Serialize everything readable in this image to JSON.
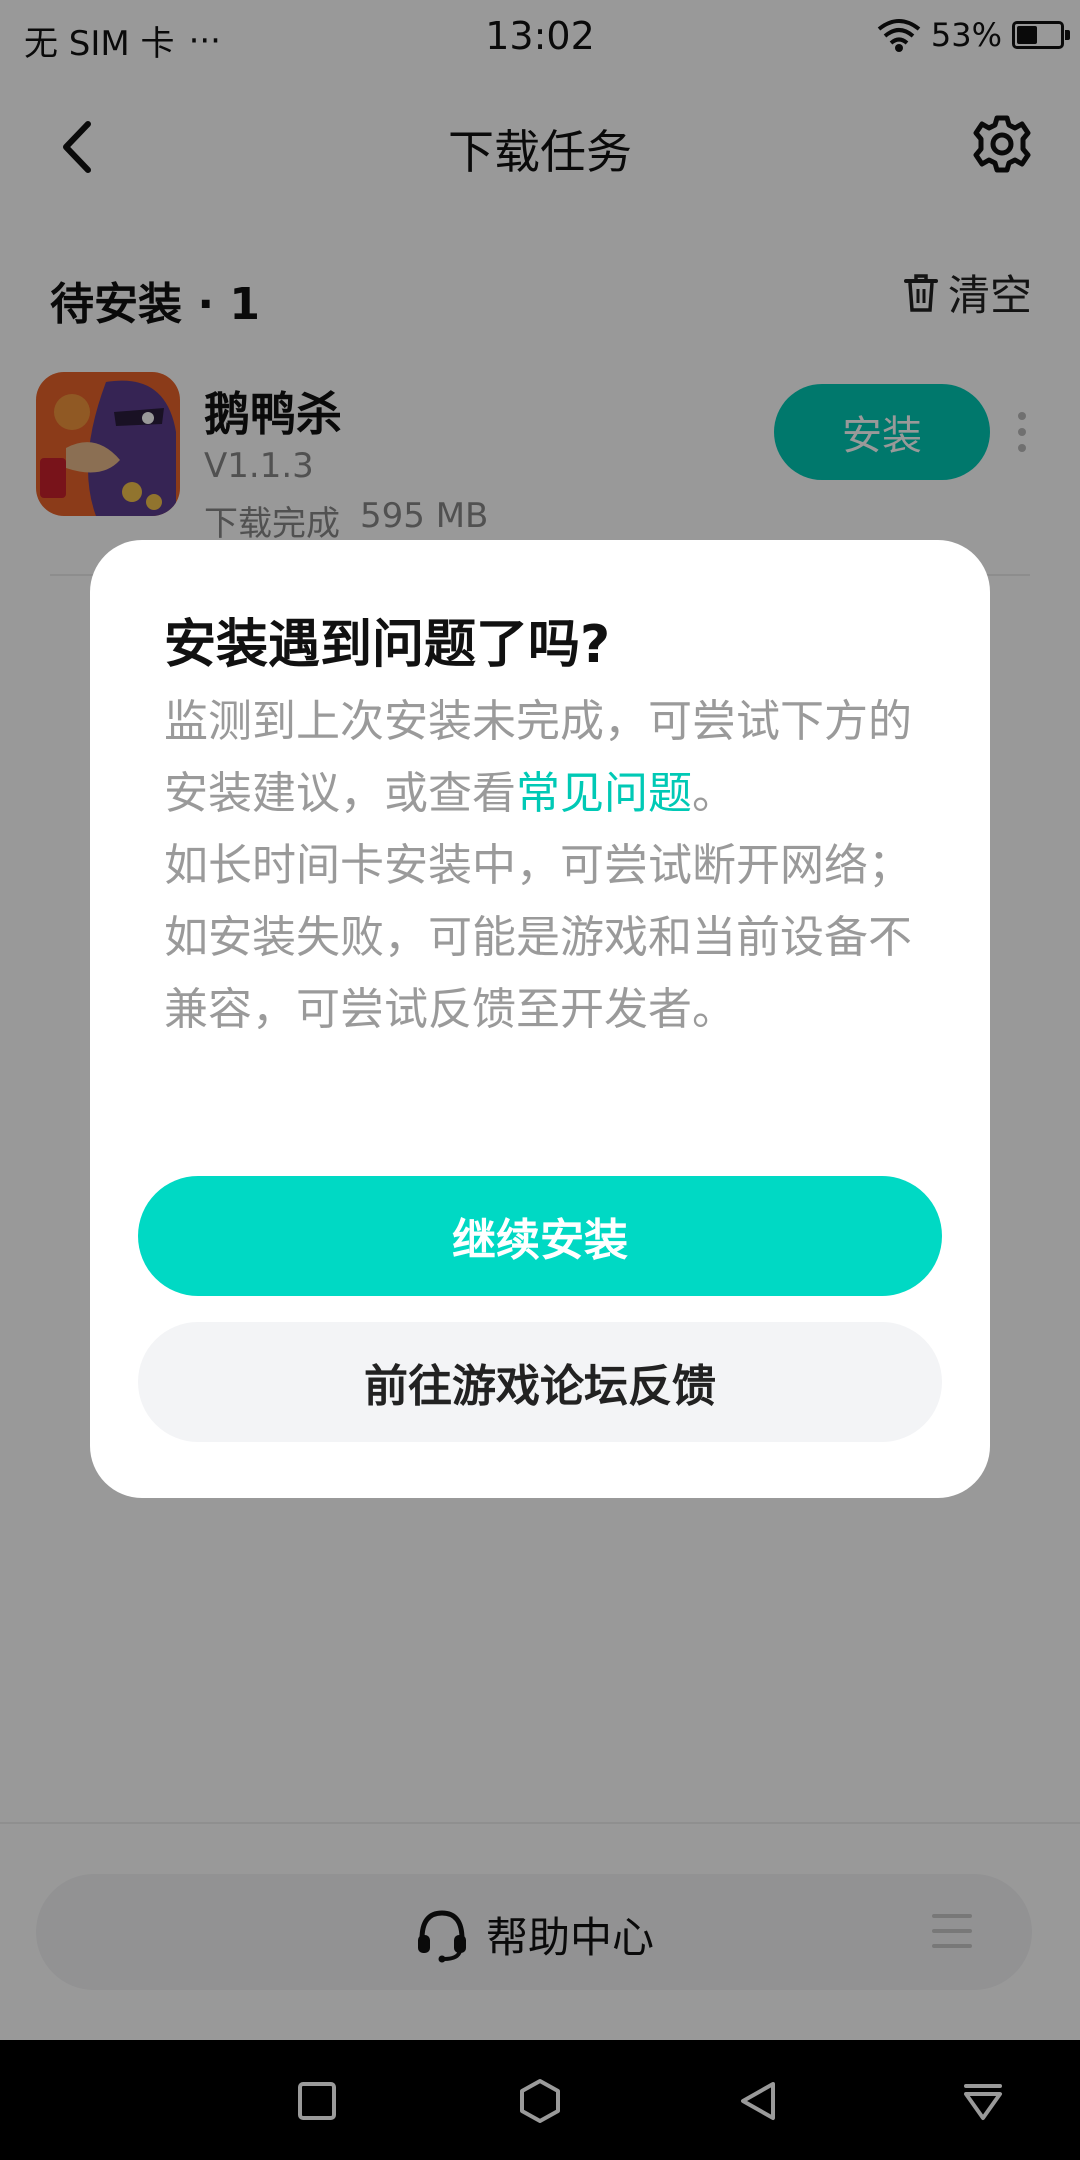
{
  "status_bar": {
    "carrier": "无 SIM 卡",
    "dots": "···",
    "time": "13:02",
    "battery": "53%",
    "battery_level": 0.53,
    "icons": [
      "wifi-icon",
      "battery-icon"
    ]
  },
  "nav": {
    "title": "下载任务",
    "back_icon": "chevron-left-icon",
    "settings_icon": "gear-icon"
  },
  "section": {
    "title": "待安装 · 1",
    "clear_label": "清空",
    "clear_icon": "trash-icon"
  },
  "app": {
    "name": "鹅鸭杀",
    "version": "V1.1.3",
    "status": "下载完成",
    "size": "595 MB",
    "install_label": "安装"
  },
  "dialog": {
    "title": "安装遇到问题了吗?",
    "body_part1": "监测到上次安装未完成，可尝试下方的安装建议，或查看",
    "link": "常见问题",
    "body_part2": "。",
    "body_line2": "如长时间卡安装中，可尝试断开网络；",
    "body_line3": "如安装失败，可能是游戏和当前设备不兼容，可尝试反馈至开发者。",
    "continue_label": "继续安装",
    "forum_label": "前往游戏论坛反馈"
  },
  "help": {
    "label": "帮助中心",
    "icon": "headset-icon",
    "menu_icon": "menu-icon"
  },
  "system_nav": [
    "square-icon",
    "home-hexagon-icon",
    "back-triangle-icon",
    "notification-down-icon"
  ],
  "colors": {
    "accent": "#00c9b5",
    "button_primary": "#00d9c4",
    "overlay": "rgba(0,0,0,0.40)"
  }
}
